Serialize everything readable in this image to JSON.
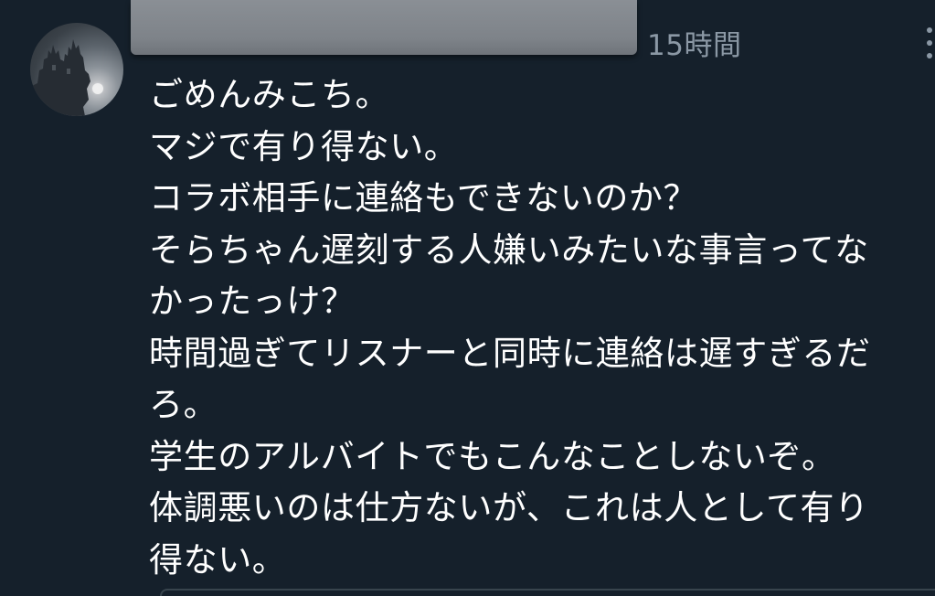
{
  "post": {
    "timestamp": "15時間",
    "more_icon": "more-vertical-icon",
    "author_name_redacted": true,
    "avatar_icon": "castle-silhouette-avatar",
    "lines": [
      "ごめんみこち。",
      "マジで有り得ない。",
      "コラボ相手に連絡もできないのか？",
      "そらちゃん遅刻する人嫌いみたいな事言ってな",
      "かったっけ？",
      "時間過ぎてリスナーと同時に連絡は遅すぎるだ",
      "ろ。",
      "学生のアルバイトでもこんなことしないぞ。",
      "体調悪いのは仕方ないが、これは人として有り",
      "得ない。"
    ]
  },
  "colors": {
    "background": "#15202b",
    "text": "#ffffff",
    "secondary_text": "#8b98a5"
  }
}
